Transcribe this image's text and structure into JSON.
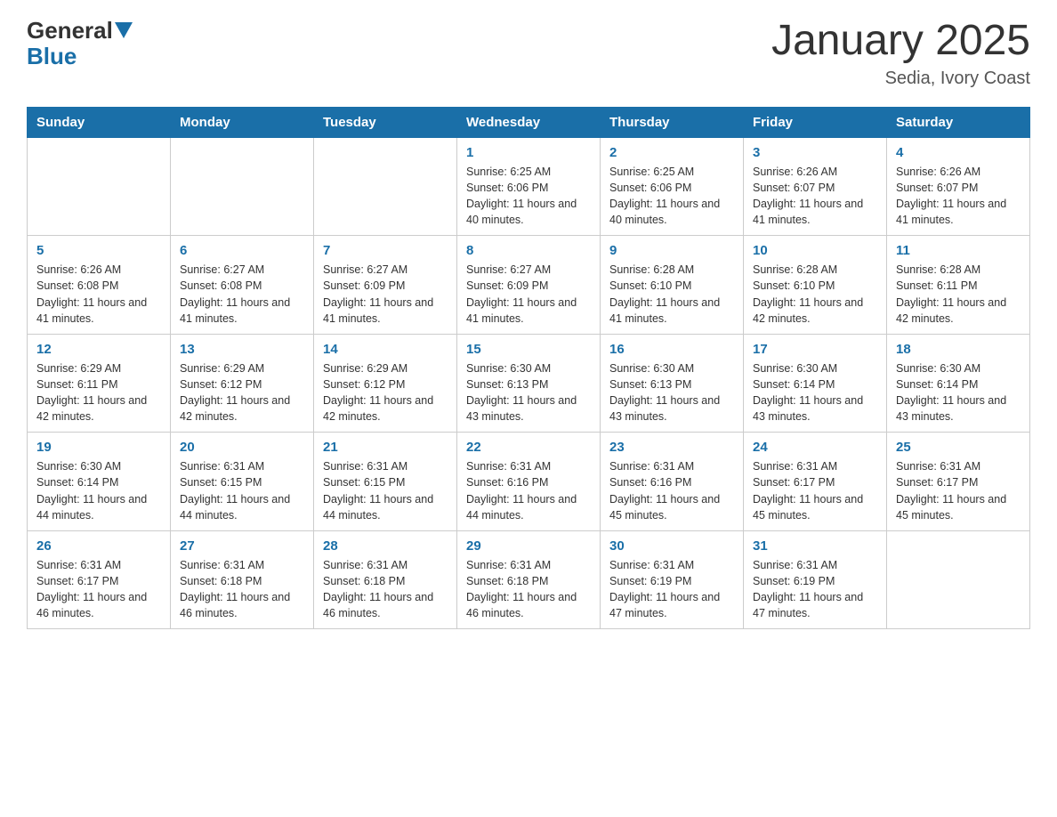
{
  "header": {
    "logo_line1": "General",
    "logo_line2": "Blue",
    "month": "January 2025",
    "location": "Sedia, Ivory Coast"
  },
  "days_of_week": [
    "Sunday",
    "Monday",
    "Tuesday",
    "Wednesday",
    "Thursday",
    "Friday",
    "Saturday"
  ],
  "weeks": [
    [
      {
        "day": "",
        "info": ""
      },
      {
        "day": "",
        "info": ""
      },
      {
        "day": "",
        "info": ""
      },
      {
        "day": "1",
        "info": "Sunrise: 6:25 AM\nSunset: 6:06 PM\nDaylight: 11 hours and 40 minutes."
      },
      {
        "day": "2",
        "info": "Sunrise: 6:25 AM\nSunset: 6:06 PM\nDaylight: 11 hours and 40 minutes."
      },
      {
        "day": "3",
        "info": "Sunrise: 6:26 AM\nSunset: 6:07 PM\nDaylight: 11 hours and 41 minutes."
      },
      {
        "day": "4",
        "info": "Sunrise: 6:26 AM\nSunset: 6:07 PM\nDaylight: 11 hours and 41 minutes."
      }
    ],
    [
      {
        "day": "5",
        "info": "Sunrise: 6:26 AM\nSunset: 6:08 PM\nDaylight: 11 hours and 41 minutes."
      },
      {
        "day": "6",
        "info": "Sunrise: 6:27 AM\nSunset: 6:08 PM\nDaylight: 11 hours and 41 minutes."
      },
      {
        "day": "7",
        "info": "Sunrise: 6:27 AM\nSunset: 6:09 PM\nDaylight: 11 hours and 41 minutes."
      },
      {
        "day": "8",
        "info": "Sunrise: 6:27 AM\nSunset: 6:09 PM\nDaylight: 11 hours and 41 minutes."
      },
      {
        "day": "9",
        "info": "Sunrise: 6:28 AM\nSunset: 6:10 PM\nDaylight: 11 hours and 41 minutes."
      },
      {
        "day": "10",
        "info": "Sunrise: 6:28 AM\nSunset: 6:10 PM\nDaylight: 11 hours and 42 minutes."
      },
      {
        "day": "11",
        "info": "Sunrise: 6:28 AM\nSunset: 6:11 PM\nDaylight: 11 hours and 42 minutes."
      }
    ],
    [
      {
        "day": "12",
        "info": "Sunrise: 6:29 AM\nSunset: 6:11 PM\nDaylight: 11 hours and 42 minutes."
      },
      {
        "day": "13",
        "info": "Sunrise: 6:29 AM\nSunset: 6:12 PM\nDaylight: 11 hours and 42 minutes."
      },
      {
        "day": "14",
        "info": "Sunrise: 6:29 AM\nSunset: 6:12 PM\nDaylight: 11 hours and 42 minutes."
      },
      {
        "day": "15",
        "info": "Sunrise: 6:30 AM\nSunset: 6:13 PM\nDaylight: 11 hours and 43 minutes."
      },
      {
        "day": "16",
        "info": "Sunrise: 6:30 AM\nSunset: 6:13 PM\nDaylight: 11 hours and 43 minutes."
      },
      {
        "day": "17",
        "info": "Sunrise: 6:30 AM\nSunset: 6:14 PM\nDaylight: 11 hours and 43 minutes."
      },
      {
        "day": "18",
        "info": "Sunrise: 6:30 AM\nSunset: 6:14 PM\nDaylight: 11 hours and 43 minutes."
      }
    ],
    [
      {
        "day": "19",
        "info": "Sunrise: 6:30 AM\nSunset: 6:14 PM\nDaylight: 11 hours and 44 minutes."
      },
      {
        "day": "20",
        "info": "Sunrise: 6:31 AM\nSunset: 6:15 PM\nDaylight: 11 hours and 44 minutes."
      },
      {
        "day": "21",
        "info": "Sunrise: 6:31 AM\nSunset: 6:15 PM\nDaylight: 11 hours and 44 minutes."
      },
      {
        "day": "22",
        "info": "Sunrise: 6:31 AM\nSunset: 6:16 PM\nDaylight: 11 hours and 44 minutes."
      },
      {
        "day": "23",
        "info": "Sunrise: 6:31 AM\nSunset: 6:16 PM\nDaylight: 11 hours and 45 minutes."
      },
      {
        "day": "24",
        "info": "Sunrise: 6:31 AM\nSunset: 6:17 PM\nDaylight: 11 hours and 45 minutes."
      },
      {
        "day": "25",
        "info": "Sunrise: 6:31 AM\nSunset: 6:17 PM\nDaylight: 11 hours and 45 minutes."
      }
    ],
    [
      {
        "day": "26",
        "info": "Sunrise: 6:31 AM\nSunset: 6:17 PM\nDaylight: 11 hours and 46 minutes."
      },
      {
        "day": "27",
        "info": "Sunrise: 6:31 AM\nSunset: 6:18 PM\nDaylight: 11 hours and 46 minutes."
      },
      {
        "day": "28",
        "info": "Sunrise: 6:31 AM\nSunset: 6:18 PM\nDaylight: 11 hours and 46 minutes."
      },
      {
        "day": "29",
        "info": "Sunrise: 6:31 AM\nSunset: 6:18 PM\nDaylight: 11 hours and 46 minutes."
      },
      {
        "day": "30",
        "info": "Sunrise: 6:31 AM\nSunset: 6:19 PM\nDaylight: 11 hours and 47 minutes."
      },
      {
        "day": "31",
        "info": "Sunrise: 6:31 AM\nSunset: 6:19 PM\nDaylight: 11 hours and 47 minutes."
      },
      {
        "day": "",
        "info": ""
      }
    ]
  ]
}
